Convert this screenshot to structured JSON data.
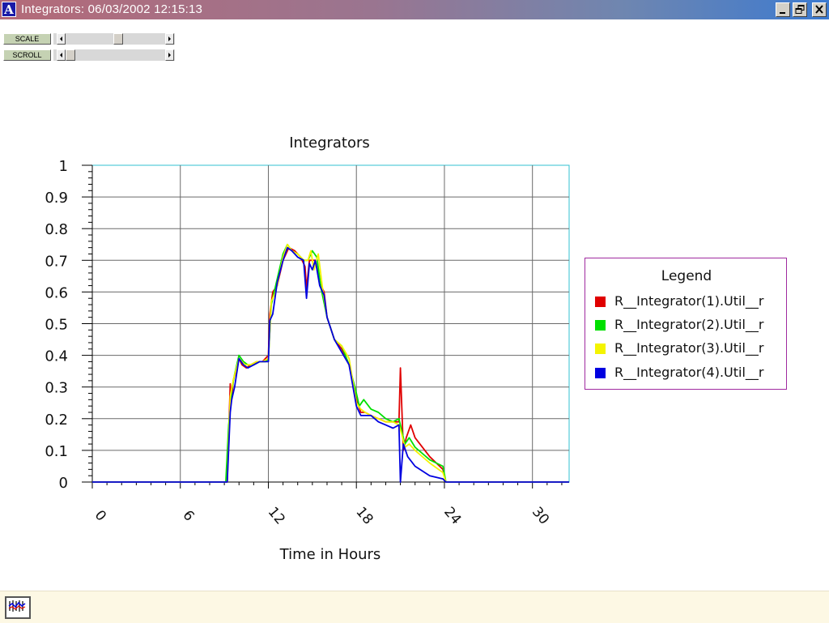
{
  "window": {
    "app_icon_letter": "A",
    "title": "Integrators: 06/03/2002 12:15:13",
    "icons": [
      "minimize-icon",
      "restore-icon",
      "close-icon"
    ]
  },
  "controls": {
    "scale_label": "SCALE",
    "scroll_label": "SCROLL",
    "scale_position": 0.53,
    "scroll_position": 0.0
  },
  "legend": {
    "title": "Legend",
    "items": [
      {
        "label": "R__Integrator(1).Util__r",
        "color": "#e00000"
      },
      {
        "label": "R__Integrator(2).Util__r",
        "color": "#00e000"
      },
      {
        "label": "R__Integrator(3).Util__r",
        "color": "#f4f400"
      },
      {
        "label": "R__Integrator(4).Util__r",
        "color": "#0000e0"
      }
    ]
  },
  "status": {
    "icon": "chart-app-icon"
  },
  "chart_data": {
    "type": "line",
    "title": "Integrators",
    "xlabel": "Time in Hours",
    "ylabel": "",
    "xlim": [
      0,
      32.5
    ],
    "ylim": [
      0,
      1
    ],
    "xticks": [
      0,
      6,
      12,
      18,
      24,
      30
    ],
    "yticks": [
      0,
      0.1,
      0.2,
      0.3,
      0.4,
      0.5,
      0.6,
      0.7,
      0.8,
      0.9,
      1
    ],
    "ytick_labels": [
      "0",
      "0.1",
      "0.2",
      "0.3",
      "0.4",
      "0.5",
      "0.6",
      "0.7",
      "0.8",
      "0.9",
      "1"
    ],
    "grid": true,
    "legend_position": "right",
    "series": [
      {
        "name": "R__Integrator(1).Util__r",
        "color": "#e00000",
        "x": [
          0,
          9.2,
          9.4,
          9.5,
          9.6,
          9.8,
          10,
          10.2,
          10.5,
          10.8,
          11.2,
          11.6,
          12,
          12.1,
          12.3,
          12.6,
          13,
          13.4,
          13.8,
          14.2,
          14.5,
          14.6,
          14.8,
          15.2,
          15.5,
          15.8,
          16,
          16.5,
          17,
          17.5,
          18,
          18.3,
          18.6,
          19,
          19.5,
          20,
          20.5,
          20.9,
          21,
          21.2,
          21.4,
          21.7,
          22,
          23,
          23.9,
          24.1,
          32.5
        ],
        "y": [
          0,
          0,
          0.31,
          0.26,
          0.32,
          0.35,
          0.39,
          0.37,
          0.36,
          0.37,
          0.38,
          0.38,
          0.4,
          0.53,
          0.6,
          0.62,
          0.7,
          0.74,
          0.73,
          0.71,
          0.68,
          0.61,
          0.7,
          0.7,
          0.63,
          0.6,
          0.52,
          0.45,
          0.42,
          0.37,
          0.26,
          0.22,
          0.22,
          0.21,
          0.2,
          0.19,
          0.19,
          0.19,
          0.36,
          0.1,
          0.14,
          0.18,
          0.14,
          0.08,
          0.04,
          0,
          0
        ]
      },
      {
        "name": "R__Integrator(2).Util__r",
        "color": "#00e000",
        "x": [
          0,
          9.1,
          9.3,
          9.5,
          9.7,
          10,
          10.3,
          10.6,
          11,
          11.4,
          11.8,
          12,
          12.2,
          12.5,
          13,
          13.3,
          13.6,
          14,
          14.4,
          14.7,
          15,
          15.3,
          15.6,
          16,
          16.5,
          17,
          17.5,
          18,
          18.2,
          18.5,
          19,
          19.5,
          20,
          20.5,
          20.9,
          21.1,
          21.3,
          21.6,
          22,
          23,
          23.9,
          24.1,
          32.5
        ],
        "y": [
          0,
          0,
          0.18,
          0.29,
          0.34,
          0.4,
          0.38,
          0.37,
          0.37,
          0.38,
          0.38,
          0.39,
          0.56,
          0.62,
          0.72,
          0.75,
          0.73,
          0.72,
          0.7,
          0.7,
          0.73,
          0.71,
          0.61,
          0.52,
          0.45,
          0.43,
          0.37,
          0.28,
          0.24,
          0.26,
          0.23,
          0.22,
          0.2,
          0.19,
          0.2,
          0.16,
          0.12,
          0.14,
          0.11,
          0.07,
          0.05,
          0,
          0
        ]
      },
      {
        "name": "R__Integrator(3).Util__r",
        "color": "#f4f400",
        "x": [
          0,
          9.2,
          9.4,
          9.6,
          10,
          10.4,
          10.8,
          11.2,
          11.6,
          12,
          12.2,
          12.5,
          13,
          13.3,
          13.6,
          14,
          14.4,
          14.7,
          14.9,
          15.1,
          15.4,
          15.7,
          16,
          16.5,
          17,
          17.5,
          18,
          18.3,
          18.6,
          19,
          19.5,
          20,
          20.5,
          20.9,
          21.1,
          21.3,
          21.6,
          22,
          23,
          23.9,
          24.1,
          32.5
        ],
        "y": [
          0,
          0,
          0.27,
          0.32,
          0.39,
          0.37,
          0.37,
          0.38,
          0.38,
          0.39,
          0.57,
          0.6,
          0.71,
          0.75,
          0.73,
          0.72,
          0.7,
          0.7,
          0.73,
          0.67,
          0.72,
          0.61,
          0.52,
          0.45,
          0.43,
          0.39,
          0.25,
          0.23,
          0.22,
          0.21,
          0.2,
          0.19,
          0.19,
          0.18,
          0.15,
          0.11,
          0.12,
          0.1,
          0.06,
          0.03,
          0,
          0
        ]
      },
      {
        "name": "R__Integrator(4).Util__r",
        "color": "#0000e0",
        "x": [
          0,
          9.2,
          9.4,
          9.5,
          9.7,
          10,
          10.3,
          10.6,
          11,
          11.4,
          11.8,
          12,
          12.1,
          12.3,
          12.6,
          13,
          13.3,
          13.6,
          14,
          14.4,
          14.6,
          14.8,
          15,
          15.2,
          15.5,
          15.8,
          16,
          16.5,
          17,
          17.5,
          18,
          18.3,
          18.6,
          19,
          19.5,
          20,
          20.5,
          20.9,
          21,
          21.2,
          21.5,
          22,
          23,
          23.9,
          24.1,
          32.5
        ],
        "y": [
          0,
          0,
          0.22,
          0.26,
          0.3,
          0.39,
          0.37,
          0.36,
          0.37,
          0.38,
          0.38,
          0.38,
          0.51,
          0.53,
          0.63,
          0.7,
          0.74,
          0.73,
          0.71,
          0.7,
          0.58,
          0.69,
          0.67,
          0.7,
          0.62,
          0.59,
          0.52,
          0.45,
          0.41,
          0.37,
          0.24,
          0.21,
          0.21,
          0.21,
          0.19,
          0.18,
          0.17,
          0.18,
          0,
          0.12,
          0.08,
          0.05,
          0.02,
          0.01,
          0,
          0
        ]
      }
    ]
  }
}
